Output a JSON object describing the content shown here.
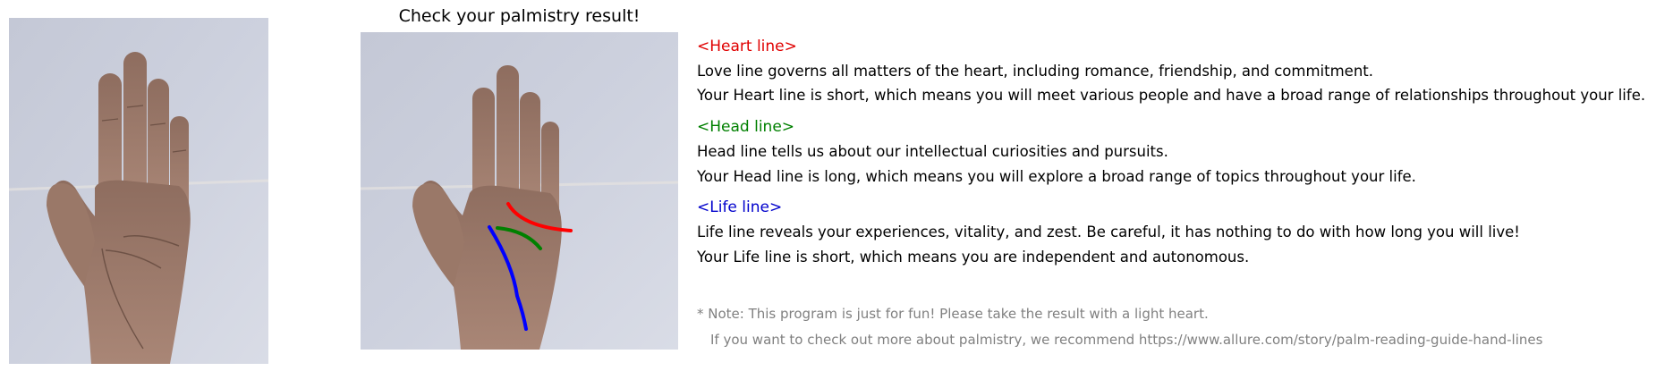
{
  "title": "Check your palmistry result!",
  "sections": [
    {
      "heading": "<Heart line>",
      "color": "#e00000",
      "description": "Love line governs all matters of the heart, including romance, friendship, and commitment.",
      "result": "Your Heart line is short, which means you will meet various people and have a broad range of relationships throughout your life."
    },
    {
      "heading": "<Head line>",
      "color": "#008000",
      "description": "Head line tells us about our intellectual curiosities and pursuits.",
      "result": "Your Head line is long, which means you will explore a broad range of topics throughout your life."
    },
    {
      "heading": "<Life line>",
      "color": "#0000cc",
      "description": "Life line reveals your experiences, vitality, and zest. Be careful, it has nothing to do with how long you will live!",
      "result": "Your Life line is short, which means you are independent and autonomous."
    }
  ],
  "note": {
    "line1": "* Note: This program is just for fun! Please take the result with a light heart.",
    "line2": "If you want to check out more about palmistry, we recommend https://www.allure.com/story/palm-reading-guide-hand-lines",
    "color": "#808080"
  },
  "line_colors": {
    "heart": "#ff0000",
    "head": "#008000",
    "life": "#0000ff"
  }
}
